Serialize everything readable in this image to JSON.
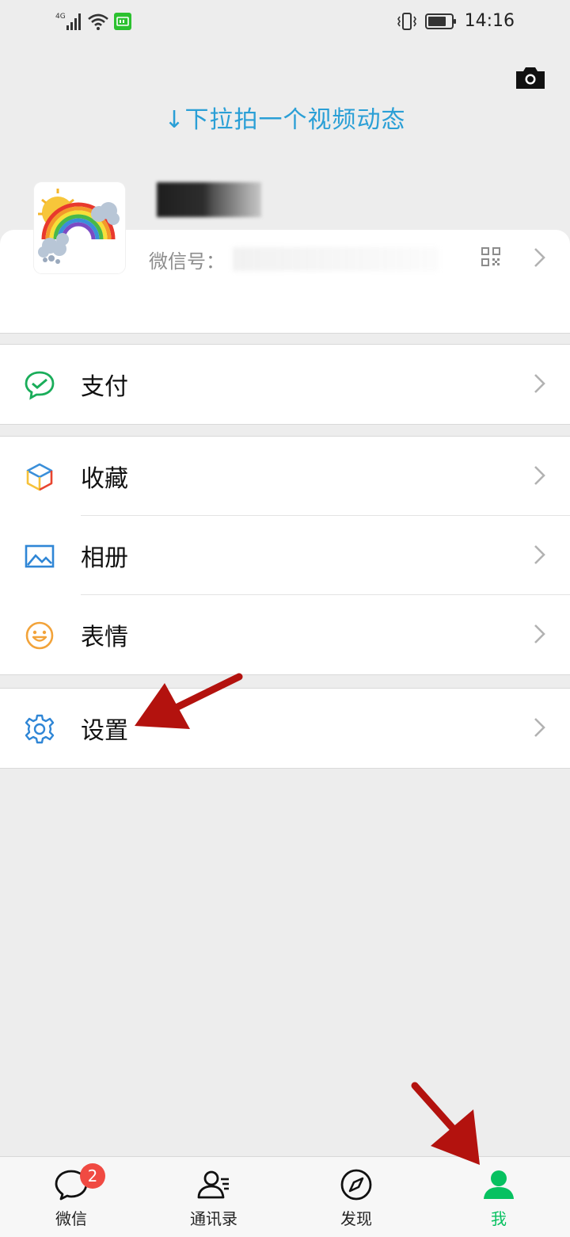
{
  "status_bar": {
    "network": "4G",
    "time": "14:16"
  },
  "header": {
    "pull_hint": "↓下拉拍一个视频动态"
  },
  "profile": {
    "wechat_id_label": "微信号："
  },
  "menu": {
    "pay": "支付",
    "favorites": "收藏",
    "album": "相册",
    "stickers": "表情",
    "settings": "设置"
  },
  "tabbar": {
    "chats": "微信",
    "chats_badge": "2",
    "contacts": "通讯录",
    "discover": "发现",
    "me": "我"
  },
  "colors": {
    "accent_green": "#07c160",
    "hint_blue": "#2a9fd6",
    "badge_red": "#f04a42",
    "annotation_arrow": "#b3120e"
  }
}
